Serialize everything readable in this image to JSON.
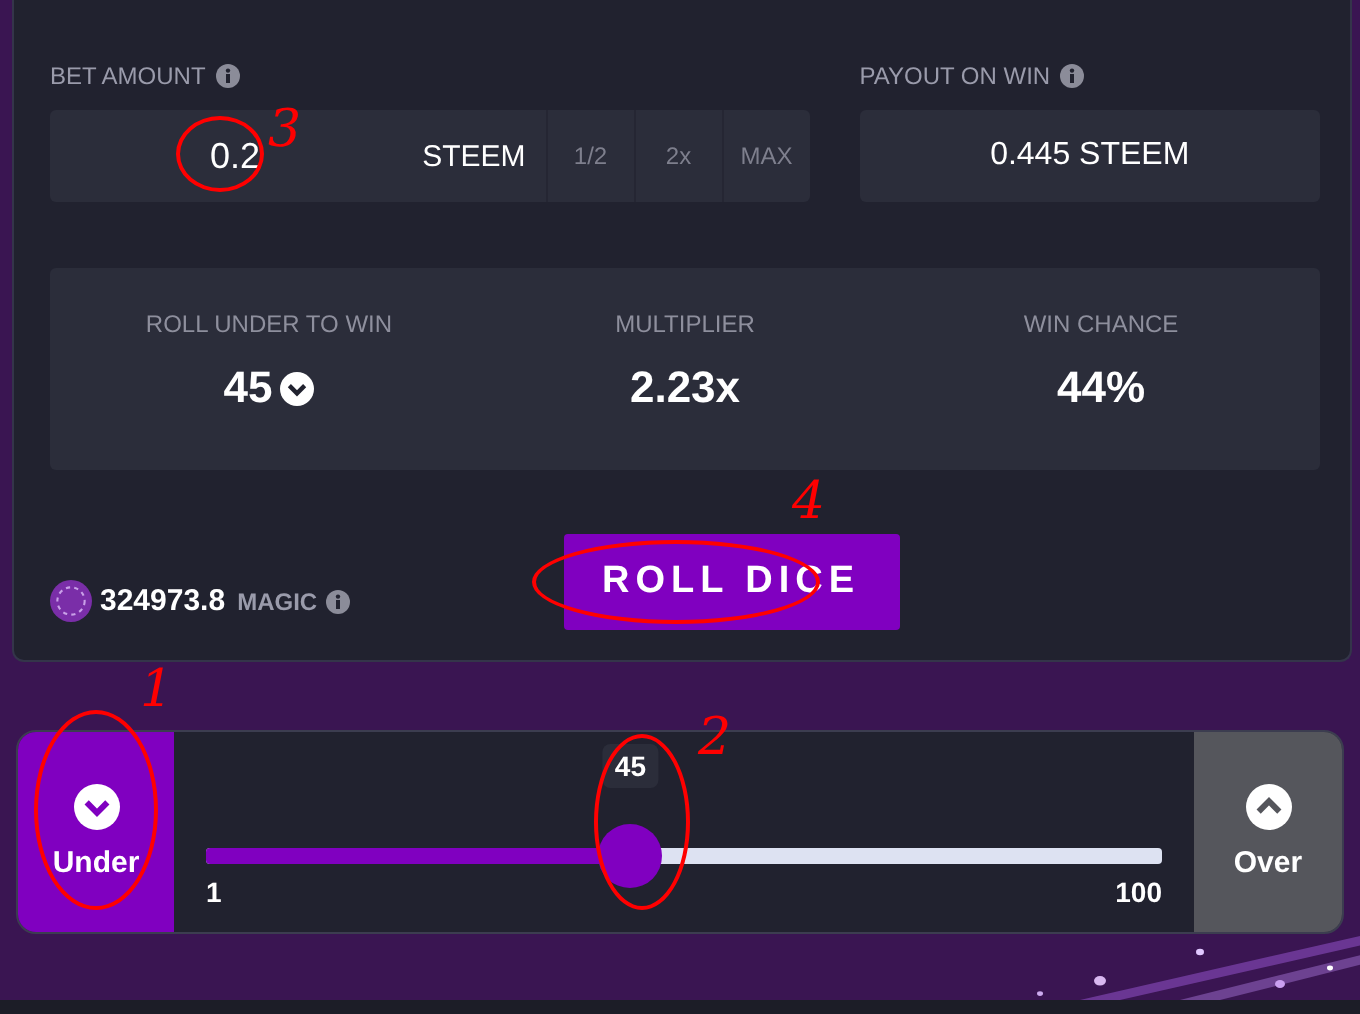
{
  "bet": {
    "label": "BET AMOUNT",
    "value": "0.2",
    "currency": "STEEM",
    "buttons": [
      "1/2",
      "2x",
      "MAX"
    ]
  },
  "payout": {
    "label": "PAYOUT ON WIN",
    "value": "0.445 STEEM"
  },
  "stats": [
    {
      "label": "ROLL UNDER TO WIN",
      "value": "45",
      "kind": "dropdown"
    },
    {
      "label": "MULTIPLIER",
      "value": "2.23x",
      "kind": "plain"
    },
    {
      "label": "WIN CHANCE",
      "value": "44%",
      "kind": "plain"
    }
  ],
  "balance": {
    "amount": "324973.8",
    "unit": "MAGIC"
  },
  "roll_button": "ROLL DICE",
  "direction": [
    {
      "label": "Under",
      "selected": true
    },
    {
      "label": "Over",
      "selected": false
    }
  ],
  "slider": {
    "value": "45",
    "level": 0.444,
    "min": "1",
    "max": "100"
  },
  "annotations": [
    {
      "label": "1"
    },
    {
      "label": "2"
    },
    {
      "label": "3"
    },
    {
      "label": "4"
    }
  ]
}
